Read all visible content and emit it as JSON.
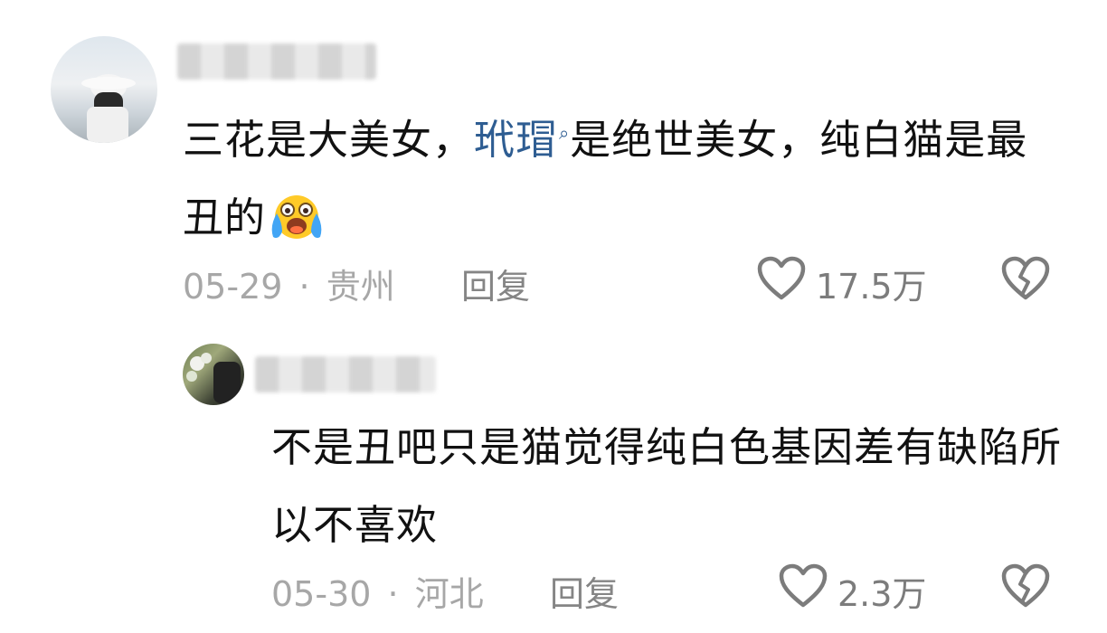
{
  "comments": [
    {
      "text_before": "三花是大美女，",
      "search_term": "玳瑁",
      "text_after": "是绝世美女，纯白猫是最丑的",
      "date": "05-29",
      "location": "贵州",
      "reply_label": "回复",
      "likes": "17.5万",
      "emoji": "crying-laughing-emoji"
    },
    {
      "text": "不是丑吧只是猫觉得纯白色基因差有缺陷所以不喜欢",
      "date": "05-30",
      "location": "河北",
      "reply_label": "回复",
      "likes": "2.3万"
    }
  ],
  "separator": "·",
  "search_icon_glyph": "⌕",
  "icons": [
    "heart-icon",
    "broken-heart-icon",
    "search-icon"
  ],
  "colors": {
    "link": "#2e5d92",
    "text": "#111111",
    "meta": "#a7a7a7",
    "icon": "#7c7c7c"
  }
}
